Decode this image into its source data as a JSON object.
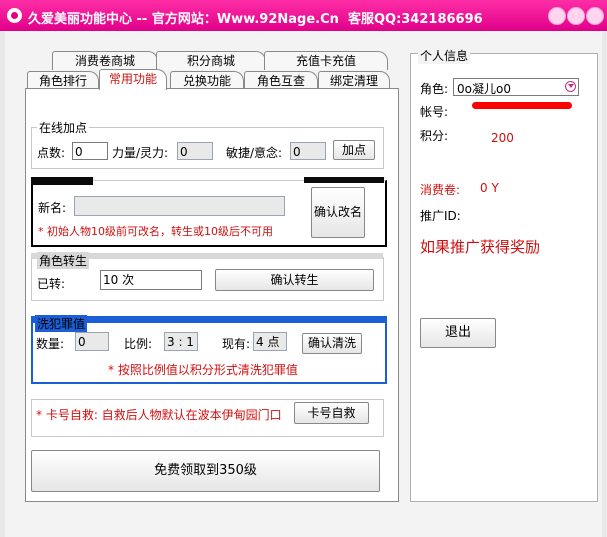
{
  "window": {
    "title": "久爱美丽功能中心 -- 官方网站：Www.92Nage.Cn  客服QQ:342186696"
  },
  "tabs_top": [
    "消费卷商城",
    "积分商城",
    "充值卡充值"
  ],
  "tabs_bottom": [
    "角色排行",
    "常用功能",
    "兑换功能",
    "角色互查",
    "绑定清理"
  ],
  "online_points": {
    "title": "在线加点",
    "points_label": "点数:",
    "points_value": "0",
    "power_label": "力量/灵力:",
    "power_value": "0",
    "agility_label": "敏捷/意念:",
    "agility_value": "0",
    "add_button": "加点"
  },
  "rename": {
    "new_name_label": "新名:",
    "new_name_value": "",
    "confirm_button": "确认改名",
    "note": "* 初始人物10级前可改名，转生或10级后不可用"
  },
  "rebirth": {
    "title": "角色转生",
    "done_label": "已转:",
    "done_value": "10 次",
    "confirm_button": "确认转生"
  },
  "clean_sin": {
    "title": "洗犯罪值",
    "amount_label": "数量:",
    "amount_value": "0",
    "ratio_label": "比例:",
    "ratio_value": "3 : 1",
    "current_label": "现有:",
    "current_value": "4 点",
    "confirm_button": "确认清洗",
    "note": "* 按照比例值以积分形式清洗犯罪值"
  },
  "self_rescue": {
    "note": "* 卡号自救: 自救后人物默认在波本伊甸园门口",
    "button": "卡号自救"
  },
  "free_level_button": "免费领取到350级",
  "info": {
    "title": "个人信息",
    "role_label": "角色:",
    "role_value": "0o凝儿o0",
    "account_label": "帐号:",
    "score_label": "积分:",
    "score_value": "200",
    "voucher_label": "消费卷:",
    "voucher_value": "0 Y",
    "promo_id_label": "推广ID:",
    "promo_text": "如果推广获得奖励",
    "exit_button": "退出"
  }
}
